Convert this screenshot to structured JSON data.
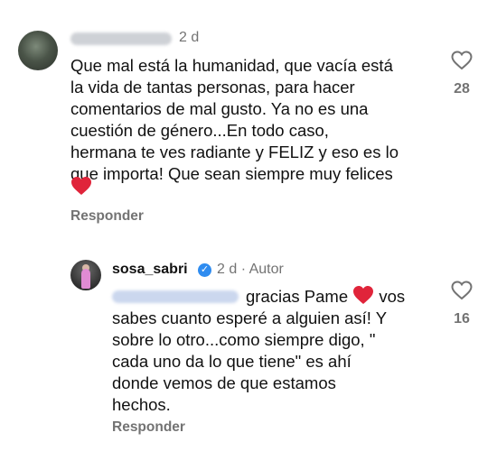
{
  "comments": [
    {
      "time": "2 d",
      "text": "Que mal está la humanidad, que vacía está\nla vida de tantas personas, para hacer\ncomentarios de mal gusto. Ya no es una\ncuestión de género...En todo caso,\nhermana te ves radiante y FELIZ y eso es lo\nque importa! Que sean siempre muy felices",
      "like_count": "28",
      "reply_label": "Responder",
      "icon": "heart-outline-icon"
    },
    {
      "username": "sosa_sabri",
      "time": "2 d",
      "separator": "·",
      "author_label": "Autor",
      "text_line1": "gracias Pame",
      "text_line1_end": "vos",
      "text_rest": "sabes cuanto esperé a alguien así! Y\nsobre lo otro...como siempre digo, \"\ncada uno da lo que tiene\" es ahí\ndonde vemos de que estamos\nhechos.",
      "like_count": "16",
      "reply_label": "Responder",
      "icon": "heart-outline-icon"
    }
  ],
  "colors": {
    "heart_emoji": "#e0243a",
    "verified": "#2f8cf0",
    "muted_text": "#737373"
  }
}
